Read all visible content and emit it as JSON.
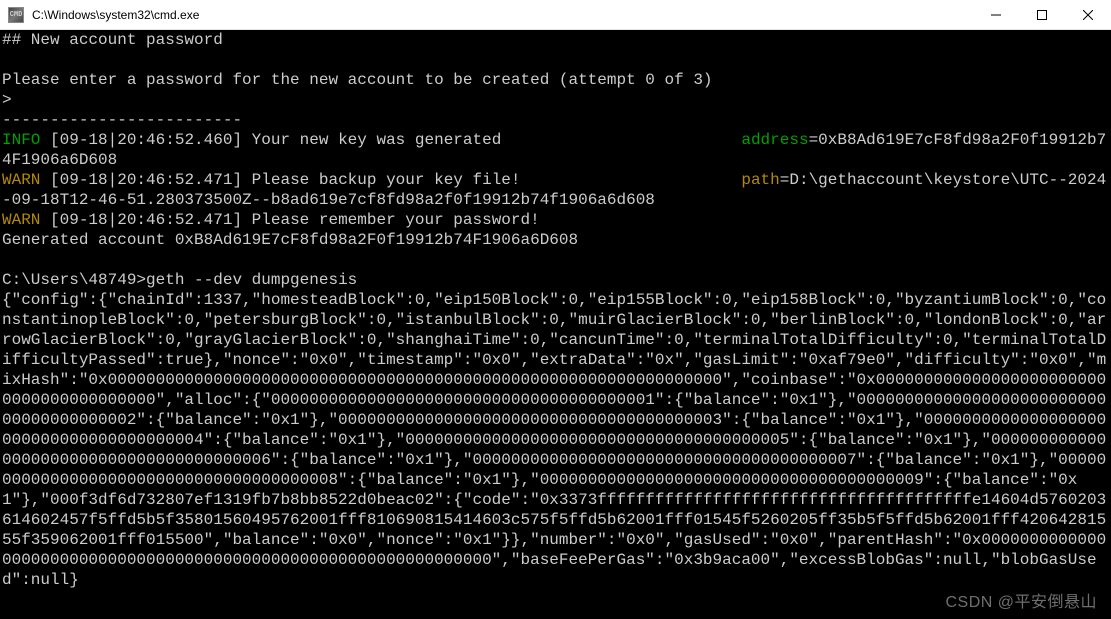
{
  "window": {
    "title": "C:\\Windows\\system32\\cmd.exe",
    "icon_label": "CMD"
  },
  "terminal": {
    "section_header": "## New account password",
    "prompt_text": "Please enter a password for the new account to be created (attempt 0 of 3)",
    "echo_prefix": ">",
    "divider": "-------------------------",
    "log_info": {
      "tag": "INFO",
      "timestamp": "[09-18|20:46:52.460]",
      "msg": "Your new key was generated",
      "key": "address",
      "value": "0xB8Ad619E7cF8fd98a2F0f19912b74F1906a6D608"
    },
    "log_warn1": {
      "tag": "WARN",
      "timestamp": "[09-18|20:46:52.471]",
      "msg": "Please backup your key file!",
      "key": "path",
      "value": "D:\\gethaccount\\keystore\\UTC--2024-09-18T12-46-51.280373500Z--b8ad619e7cf8fd98a2f0f19912b74f1906a6d608"
    },
    "log_warn2": {
      "tag": "WARN",
      "timestamp": "[09-18|20:46:52.471]",
      "msg": "Please remember your password!"
    },
    "generated_line": "Generated account 0xB8Ad619E7cF8fd98a2F0f19912b74F1906a6D608",
    "prompt2": "C:\\Users\\48749>",
    "command2": "geth --dev dumpgenesis",
    "genesis_json": "{\"config\":{\"chainId\":1337,\"homesteadBlock\":0,\"eip150Block\":0,\"eip155Block\":0,\"eip158Block\":0,\"byzantiumBlock\":0,\"constantinopleBlock\":0,\"petersburgBlock\":0,\"istanbulBlock\":0,\"muirGlacierBlock\":0,\"berlinBlock\":0,\"londonBlock\":0,\"arrowGlacierBlock\":0,\"grayGlacierBlock\":0,\"shanghaiTime\":0,\"cancunTime\":0,\"terminalTotalDifficulty\":0,\"terminalTotalDifficultyPassed\":true},\"nonce\":\"0x0\",\"timestamp\":\"0x0\",\"extraData\":\"0x\",\"gasLimit\":\"0xaf79e0\",\"difficulty\":\"0x0\",\"mixHash\":\"0x0000000000000000000000000000000000000000000000000000000000000000\",\"coinbase\":\"0x0000000000000000000000000000000000000000\",\"alloc\":{\"0000000000000000000000000000000000000001\":{\"balance\":\"0x1\"},\"0000000000000000000000000000000000000002\":{\"balance\":\"0x1\"},\"0000000000000000000000000000000000000003\":{\"balance\":\"0x1\"},\"0000000000000000000000000000000000000004\":{\"balance\":\"0x1\"},\"0000000000000000000000000000000000000005\":{\"balance\":\"0x1\"},\"0000000000000000000000000000000000000006\":{\"balance\":\"0x1\"},\"0000000000000000000000000000000000000007\":{\"balance\":\"0x1\"},\"0000000000000000000000000000000000000008\":{\"balance\":\"0x1\"},\"0000000000000000000000000000000000000009\":{\"balance\":\"0x1\"},\"000f3df6d732807ef1319fb7b8bb8522d0beac02\":{\"code\":\"0x3373fffffffffffffffffffffffffffffffffffffffe14604d5760203614602457f5ffd5b5f35801560495762001fff810690815414603c575f5ffd5b62001fff01545f5260205ff35b5f5ffd5b62001fff42064281555f359062001fff015500\",\"balance\":\"0x0\",\"nonce\":\"0x1\"}},\"number\":\"0x0\",\"gasUsed\":\"0x0\",\"parentHash\":\"0x0000000000000000000000000000000000000000000000000000000000000000\",\"baseFeePerGas\":\"0x3b9aca00\",\"excessBlobGas\":null,\"blobGasUsed\":null}",
    "watermark": "CSDN @平安倒悬山"
  }
}
